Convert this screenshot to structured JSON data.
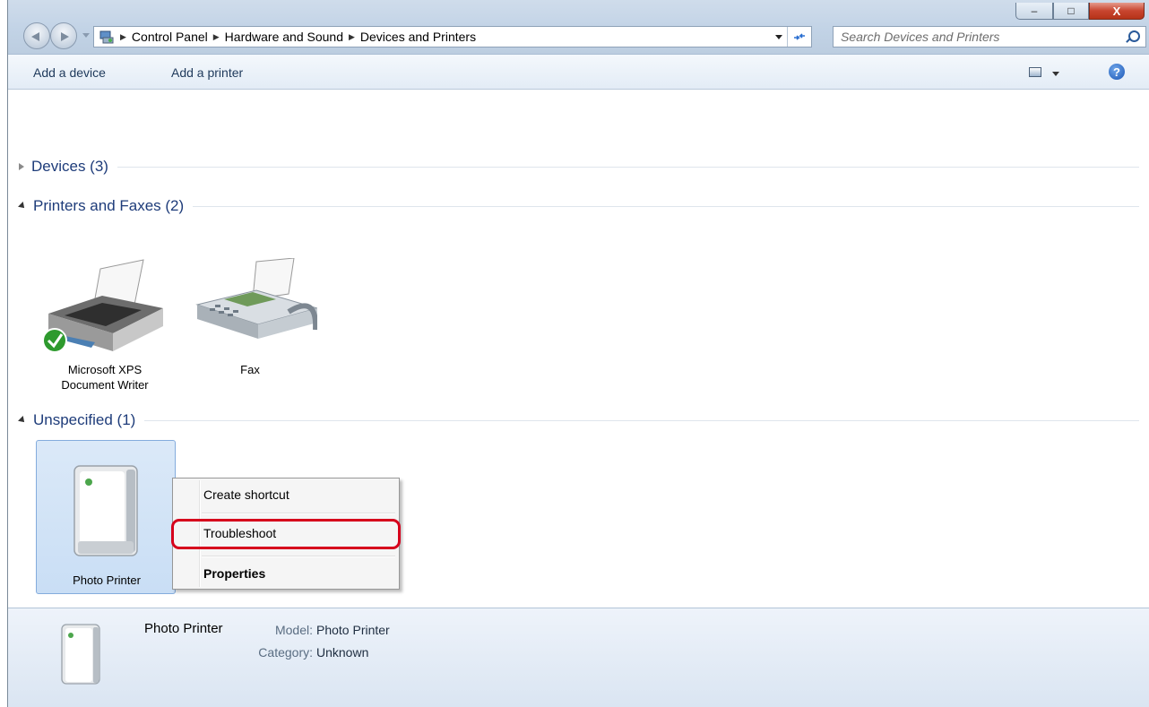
{
  "window": {
    "minimize_label": "–",
    "maximize_label": "□",
    "close_label": "X"
  },
  "address": {
    "crumbs": [
      "Control Panel",
      "Hardware and Sound",
      "Devices and Printers"
    ],
    "separator": "▶"
  },
  "search": {
    "placeholder": "Search Devices and Printers"
  },
  "toolbar": {
    "add_device": "Add a device",
    "add_printer": "Add a printer",
    "help": "?"
  },
  "groups": {
    "devices": "Devices (3)",
    "printers": "Printers and Faxes (2)",
    "unspecified": "Unspecified (1)"
  },
  "items": {
    "xps_line1": "Microsoft XPS",
    "xps_line2": "Document Writer",
    "fax": "Fax",
    "photo_printer": "Photo Printer"
  },
  "context_menu": {
    "create_shortcut": "Create shortcut",
    "troubleshoot": "Troubleshoot",
    "properties": "Properties"
  },
  "details": {
    "name": "Photo Printer",
    "model_key": "Model:",
    "model_value": "Photo Printer",
    "category_key": "Category:",
    "category_value": "Unknown"
  }
}
